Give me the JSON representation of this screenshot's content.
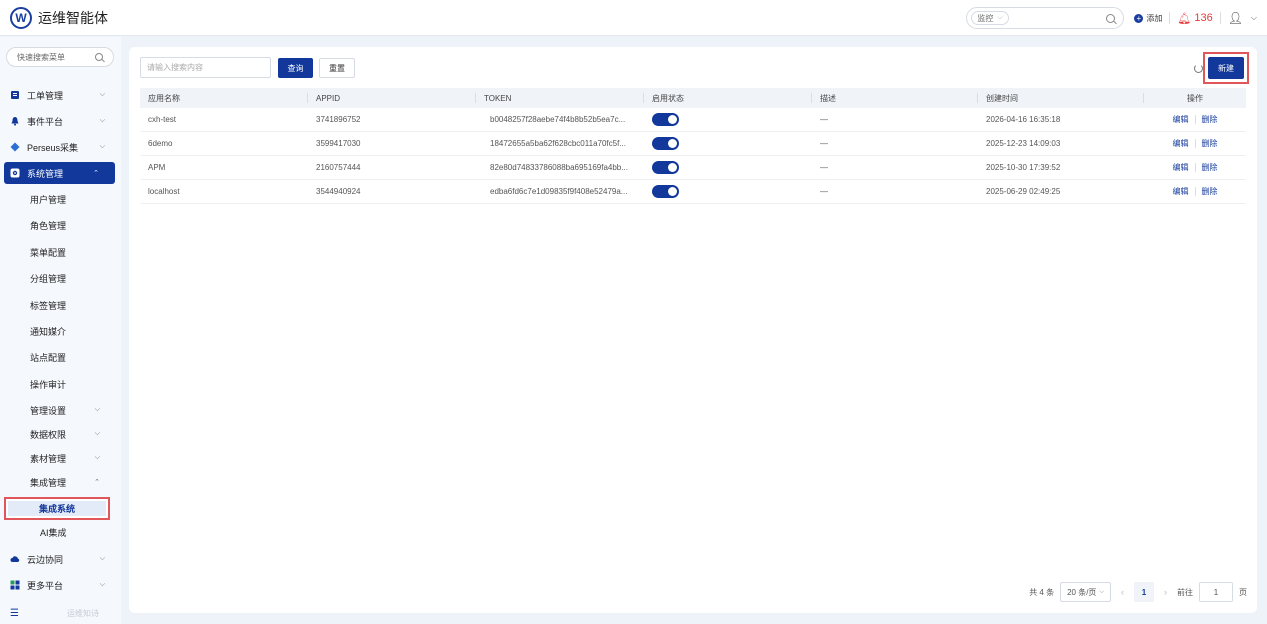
{
  "app": {
    "logo_letter": "W",
    "title": "运维智能体"
  },
  "header": {
    "search_scope": "监控",
    "add_label": "添加",
    "alert_count": "136"
  },
  "sidebar": {
    "search_placeholder": "快速搜索菜单",
    "top_items": [
      {
        "label": "工单管理",
        "icon": "ticket-icon"
      },
      {
        "label": "事件平台",
        "icon": "bell-icon"
      },
      {
        "label": "Perseus采集",
        "icon": "diamond-icon"
      },
      {
        "label": "系统管理",
        "icon": "gear-icon"
      }
    ],
    "sub_items": [
      "用户管理",
      "角色管理",
      "菜单配置",
      "分组管理",
      "标签管理",
      "通知媒介",
      "站点配置",
      "操作审计"
    ],
    "sub_groups": [
      "管理设置",
      "数据权限",
      "素材管理",
      "集成管理"
    ],
    "selected": "集成系统",
    "after_selected": "AI集成",
    "bottom_items": [
      {
        "label": "云边协同",
        "icon": "cloud-icon"
      },
      {
        "label": "更多平台",
        "icon": "grid-icon"
      }
    ],
    "footer_text": "运维知诗"
  },
  "toolbar": {
    "search_placeholder": "请输入搜索内容",
    "query_label": "查询",
    "reset_label": "重置",
    "new_label": "新建"
  },
  "table": {
    "columns": [
      "应用名称",
      "APPID",
      "TOKEN",
      "启用状态",
      "描述",
      "创建时间",
      "操作"
    ],
    "rows": [
      {
        "name": "cxh-test",
        "appid": "3741896752",
        "token": "b0048257f28aebe74f4b8b52b5ea7c...",
        "desc": "—",
        "created": "2026-04-16 16:35:18"
      },
      {
        "name": "6demo",
        "appid": "3599417030",
        "token": "18472655a5ba62f628cbc011a70fc5f...",
        "desc": "—",
        "created": "2025-12-23 14:09:03"
      },
      {
        "name": "APM",
        "appid": "2160757444",
        "token": "82e80d74833786088ba695169fa4bb...",
        "desc": "—",
        "created": "2025-10-30 17:39:52"
      },
      {
        "name": "localhost",
        "appid": "3544940924",
        "token": "edba6fd6c7e1d09835f9f408e52479a...",
        "desc": "—",
        "created": "2025-06-29 02:49:25"
      }
    ],
    "edit_label": "编辑",
    "delete_label": "删除"
  },
  "pagination": {
    "total": "共 4 条",
    "page_size": "20 条/页",
    "current": "1",
    "goto_label": "前往",
    "goto_value": "1",
    "page_unit": "页"
  }
}
